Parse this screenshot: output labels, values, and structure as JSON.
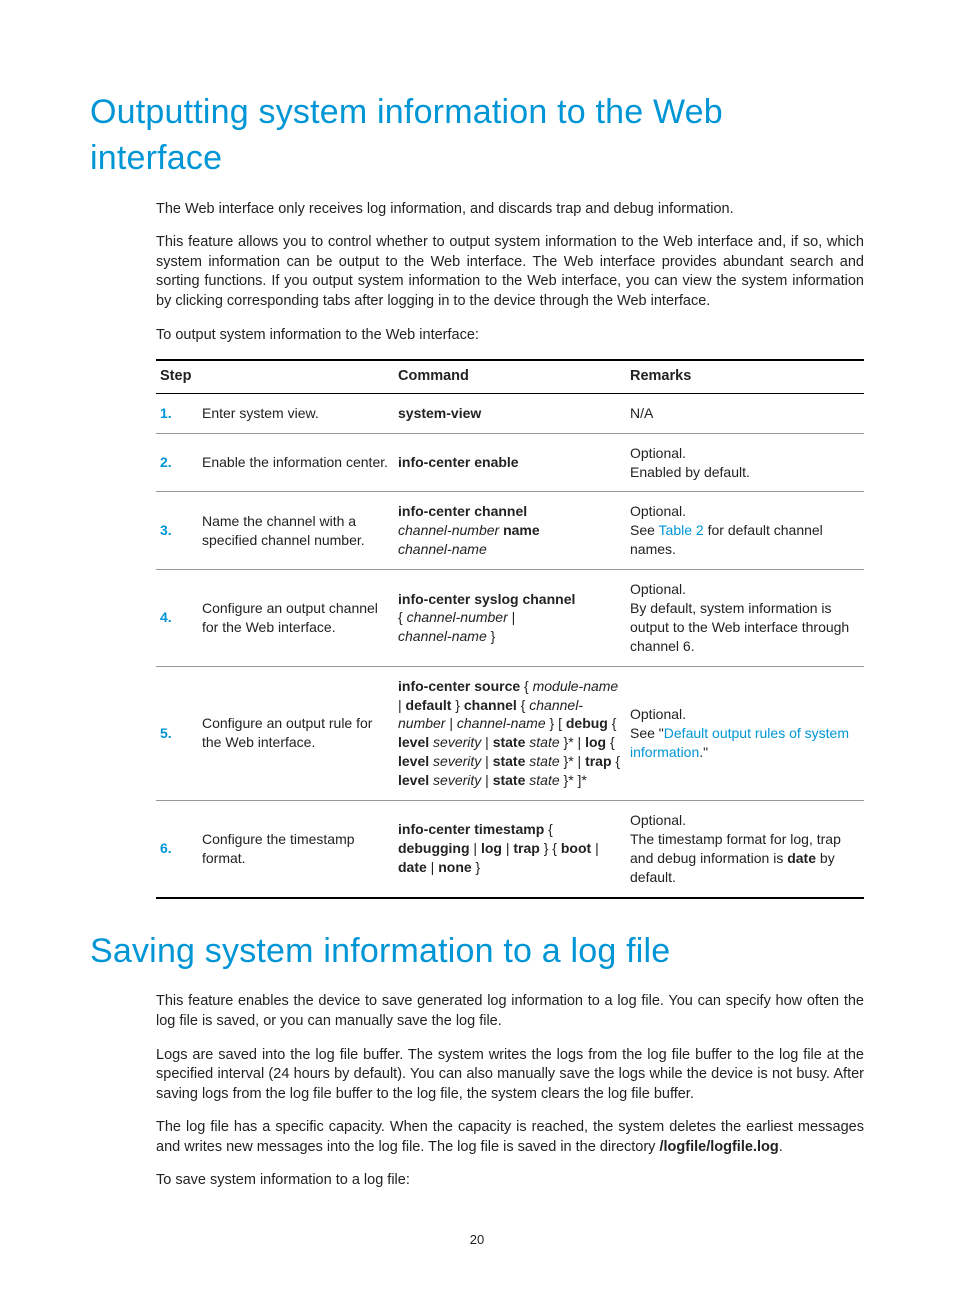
{
  "page_number": "20",
  "section1": {
    "title": "Outputting system information to the Web interface",
    "p1": "The Web interface only receives log information, and discards trap and debug information.",
    "p2": "This feature allows you to control whether to output system information to the Web interface and, if so, which system information can be output to the Web interface. The Web interface provides abundant search and sorting functions. If you output system information to the Web interface, you can view the system information by clicking corresponding tabs after logging in to the device through the Web interface.",
    "p3": "To output system information to the Web interface:"
  },
  "table": {
    "head": {
      "step": "Step",
      "command": "Command",
      "remarks": "Remarks"
    },
    "row1": {
      "num": "1.",
      "step": "Enter system view.",
      "cmd_b1": "system-view",
      "rem": "N/A"
    },
    "row2": {
      "num": "2.",
      "step": "Enable the information center.",
      "cmd_b1": "info-center enable",
      "rem1": "Optional.",
      "rem2": "Enabled by default."
    },
    "row3": {
      "num": "3.",
      "step": "Name the channel with a specified channel number.",
      "cmd_b1": "info-center channel",
      "cmd_i1": "channel-number",
      "cmd_b2": "name",
      "cmd_i2": "channel-name",
      "rem1": "Optional.",
      "rem2a": "See ",
      "rem2link": "Table 2",
      "rem2b": " for default channel names."
    },
    "row4": {
      "num": "4.",
      "step": "Configure an output channel for the Web interface.",
      "cmd_b1": "info-center syslog channel",
      "cmd_t1": "{ ",
      "cmd_i1": "channel-number",
      "cmd_t2": " | ",
      "cmd_i2": "channel-name",
      "cmd_t3": " }",
      "rem1": "Optional.",
      "rem2": "By default, system information is output to the Web interface through channel 6."
    },
    "row5": {
      "num": "5.",
      "step": "Configure an output rule for the Web interface.",
      "cmd_b1": "info-center source",
      "cmd_t1": " { ",
      "cmd_i1": "module-name",
      "cmd_t2": " | ",
      "cmd_b2": "default",
      "cmd_t3": " } ",
      "cmd_b3": "channel",
      "cmd_t4": " { ",
      "cmd_i2": "channel-number",
      "cmd_t5": " | ",
      "cmd_i3": "channel-name",
      "cmd_t6": " } [ ",
      "cmd_b4": "debug",
      "cmd_t7": " { ",
      "cmd_b5": "level",
      "cmd_t8": " ",
      "cmd_i4": "severity",
      "cmd_t9": " | ",
      "cmd_b6": "state",
      "cmd_t10": " ",
      "cmd_i5": "state",
      "cmd_t11": " }* | ",
      "cmd_b7": "log",
      "cmd_t12": " { ",
      "cmd_b8": "level",
      "cmd_t13": " ",
      "cmd_i6": "severity",
      "cmd_t14": " | ",
      "cmd_b9": "state",
      "cmd_t15": " ",
      "cmd_i7": "state",
      "cmd_t16": " }* | ",
      "cmd_b10": "trap",
      "cmd_t17": " { ",
      "cmd_b11": "level",
      "cmd_t18": " ",
      "cmd_i8": "severity",
      "cmd_t19": " | ",
      "cmd_b12": "state",
      "cmd_t20": " ",
      "cmd_i9": "state",
      "cmd_t21": " }* ]*",
      "rem1": "Optional.",
      "rem2a": "See \"",
      "rem2link": "Default output rules of system information",
      "rem2b": ".\""
    },
    "row6": {
      "num": "6.",
      "step": "Configure the timestamp format.",
      "cmd_b1": "info-center timestamp",
      "cmd_t1": " { ",
      "cmd_b2": "debugging",
      "cmd_t2": " | ",
      "cmd_b3": "log",
      "cmd_t3": " | ",
      "cmd_b4": "trap",
      "cmd_t4": " } { ",
      "cmd_b5": "boot",
      "cmd_t5": " | ",
      "cmd_b6": "date",
      "cmd_t6": " | ",
      "cmd_b7": "none",
      "cmd_t7": " }",
      "rem1": "Optional.",
      "rem2a": "The timestamp format for log, trap and debug information is ",
      "rem2b": "date",
      "rem2c": " by default."
    }
  },
  "section2": {
    "title": "Saving system information to a log file",
    "p1": "This feature enables the device to save generated log information to a log file. You can specify how often the log file is saved, or you can manually save the log file.",
    "p2": "Logs are saved into the log file buffer. The system writes the logs from the log file buffer to the log file at the specified interval (24 hours by default). You can also manually save the logs while the device is not busy. After saving logs from the log file buffer to the log file, the system clears the log file buffer.",
    "p3a": "The log file has a specific capacity. When the capacity is reached, the system deletes the earliest messages and writes new messages into the log file. The log file is saved in the directory ",
    "p3b": "/logfile/logfile.log",
    "p3c": ".",
    "p4": "To save system information to a log file:"
  }
}
